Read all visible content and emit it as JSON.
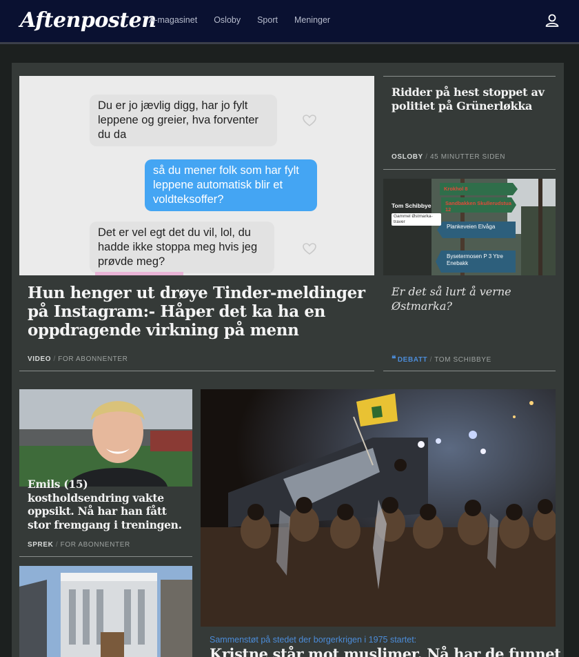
{
  "header": {
    "logo": "Aftenposten",
    "nav": [
      "A-magasinet",
      "Osloby",
      "Sport",
      "Meninger"
    ],
    "user_icon": "user-icon"
  },
  "lead": {
    "chat": {
      "msg1": "Du er jo jævlig digg, har jo fylt leppene og greier, hva forventer du da",
      "msg2": "så du mener folk som har fylt leppene automatisk blir et voldteksoffer?",
      "msg3": "Det er vel egt det du vil, lol, du hadde ikke stoppa meg hvis jeg prøvde meg?"
    },
    "title": "Hun henger ut drøye Tinder-meldinger på Instagram:- Håper det ka ha en oppdragende virkning på menn",
    "meta_tag": "VIDEO",
    "meta_rest": "FOR ABONNENTER"
  },
  "right": {
    "story1": {
      "title": "Ridder på hest stoppet av politiet på Grünerløkka",
      "meta_tag": "OSLOBY",
      "meta_rest": "45 MINUTTER SIDEN"
    },
    "story2": {
      "img_name": "Tom Schibbye",
      "img_caption": "Gammel Østmarka-traver",
      "signs": [
        "Krokhol 8",
        "Sandbakken Skullerudstua 12",
        "Plankeveien Elvåga",
        "Bysetermosen P 3 Ytre Enebakk"
      ],
      "title": "Er det så lurt å verne Østmarka?",
      "meta_tag": "DEBATT",
      "meta_rest": "TOM SCHIBBYE"
    }
  },
  "second": {
    "story1": {
      "title": "Emils (15) kostholdsendring vakte oppsikt. Nå har han fått stor fremgang i treningen.",
      "meta_tag": "SPREK",
      "meta_rest": "FOR ABONNENTER"
    },
    "big": {
      "kicker": "Sammenstøt på stedet der borgerkrigen i 1975 startet:",
      "title": "Kristne står mot muslimer. Nå har de funnet"
    }
  },
  "colors": {
    "header_bg": "#0a1131",
    "panel_bg": "#353a38",
    "page_bg": "#1c201f",
    "kicker_blue": "#4c8cd8",
    "debatt_blue": "#4c8cd8"
  }
}
